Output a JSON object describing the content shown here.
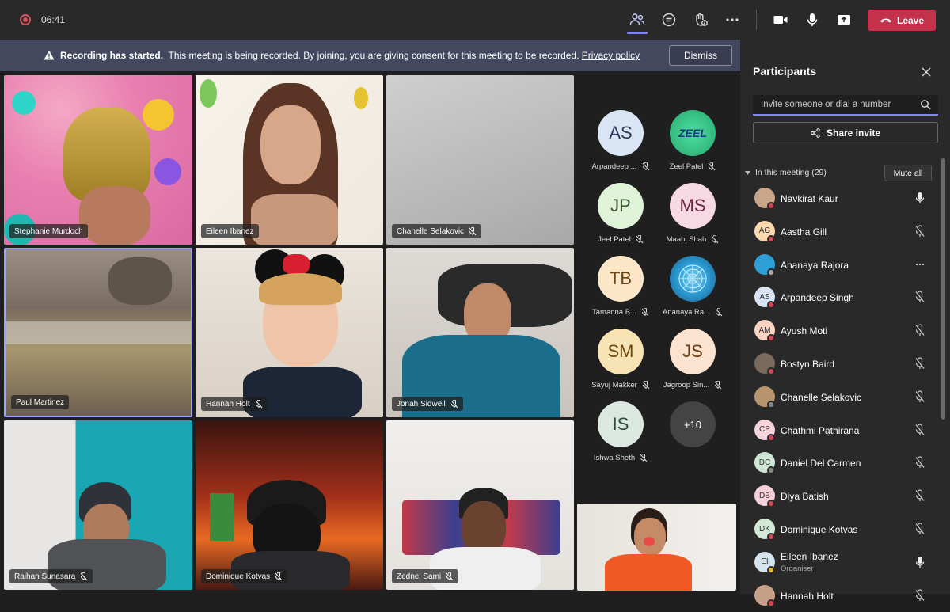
{
  "topbar": {
    "timer": "06:41",
    "leave_label": "Leave"
  },
  "banner": {
    "title": "Recording has started.",
    "message": "This meeting is being recorded. By joining, you are giving consent for this meeting to be recorded.",
    "link": "Privacy policy",
    "dismiss_label": "Dismiss"
  },
  "tiles": [
    {
      "name": "Stephanie Murdoch",
      "muted": false
    },
    {
      "name": "Eileen Ibanez",
      "muted": false
    },
    {
      "name": "Chanelle Selakovic",
      "muted": true
    },
    {
      "name": "Paul Martinez",
      "muted": false
    },
    {
      "name": "Hannah Holt",
      "muted": true
    },
    {
      "name": "Jonah Sidwell",
      "muted": true
    },
    {
      "name": "Raihan Sunasara",
      "muted": true
    },
    {
      "name": "Dominique Kotvas",
      "muted": true
    },
    {
      "name": "Zednel Sami",
      "muted": true
    }
  ],
  "avatars": [
    {
      "initials": "AS",
      "name": "Arpandeep ...",
      "bg": "#d9e4f5",
      "fg": "#2c3e5c"
    },
    {
      "initials": "",
      "name": "Zeel Patel",
      "bg": "#3fcf8e",
      "fg": "#1a3a8a",
      "logo": "ZEEL"
    },
    {
      "initials": "JP",
      "name": "Jeel Patel",
      "bg": "#dff3d8",
      "fg": "#3d5a2f"
    },
    {
      "initials": "MS",
      "name": "Maahi Shah",
      "bg": "#f7d9e3",
      "fg": "#6b2840"
    },
    {
      "initials": "TB",
      "name": "Tamanna B...",
      "bg": "#fbe7c8",
      "fg": "#6b4410"
    },
    {
      "initials": "",
      "name": "Ananaya Ra...",
      "bg": "#2d9fd6",
      "fg": "#fff"
    },
    {
      "initials": "SM",
      "name": "Sayuj Makker",
      "bg": "#f8e3b4",
      "fg": "#6b4a10"
    },
    {
      "initials": "JS",
      "name": "Jagroop Sin...",
      "bg": "#fbe3cf",
      "fg": "#6b3a10"
    },
    {
      "initials": "IS",
      "name": "Ishwa Sheth",
      "bg": "#dbe8e0",
      "fg": "#2d4a3a"
    },
    {
      "initials": "+10",
      "name": "",
      "bg": "#444",
      "fg": "#fff"
    }
  ],
  "panel": {
    "title": "Participants",
    "invite_placeholder": "Invite someone or dial a number",
    "share_label": "Share invite",
    "section_label": "In this meeting (29)",
    "mute_all_label": "Mute all",
    "participants": [
      {
        "name": "Navkirat Kaur",
        "initials": "",
        "bg": "#c9a58a",
        "status": "#d74654",
        "icon": "mic",
        "sub": ""
      },
      {
        "name": "Aastha Gill",
        "initials": "AG",
        "bg": "#fbd8b0",
        "status": "#d74654",
        "icon": "mic-off",
        "sub": ""
      },
      {
        "name": "Ananaya Rajora",
        "initials": "",
        "bg": "#2d9fd6",
        "status": "#aaaaaa",
        "icon": "more",
        "sub": ""
      },
      {
        "name": "Arpandeep Singh",
        "initials": "AS",
        "bg": "#d9e4f5",
        "status": "#d74654",
        "icon": "mic-off",
        "sub": ""
      },
      {
        "name": "Ayush Moti",
        "initials": "AM",
        "bg": "#fbd3c0",
        "status": "#d74654",
        "icon": "mic-off",
        "sub": ""
      },
      {
        "name": "Bostyn Baird",
        "initials": "",
        "bg": "#7a6a5e",
        "status": "#d74654",
        "icon": "mic-off",
        "sub": ""
      },
      {
        "name": "Chanelle Selakovic",
        "initials": "",
        "bg": "#b8956e",
        "status": "#8a8a8a",
        "icon": "mic-off",
        "sub": ""
      },
      {
        "name": "Chathmi Pathirana",
        "initials": "CP",
        "bg": "#f7d4dc",
        "status": "#d74654",
        "icon": "mic-off",
        "sub": ""
      },
      {
        "name": "Daniel Del Carmen",
        "initials": "DC",
        "bg": "#cfe6d6",
        "status": "#8a8a8a",
        "icon": "mic-off",
        "sub": ""
      },
      {
        "name": "Diya Batish",
        "initials": "DB",
        "bg": "#f5d0d8",
        "status": "#d74654",
        "icon": "mic-off",
        "sub": ""
      },
      {
        "name": "Dominique Kotvas",
        "initials": "DK",
        "bg": "#d3e8d6",
        "status": "#d74654",
        "icon": "mic-off",
        "sub": ""
      },
      {
        "name": "Eileen Ibanez",
        "initials": "EI",
        "bg": "#d6e4f0",
        "status": "#e8b73a",
        "icon": "mic",
        "sub": "Organiser"
      },
      {
        "name": "Hannah Holt",
        "initials": "",
        "bg": "#c7a08a",
        "status": "#d74654",
        "icon": "mic-off",
        "sub": ""
      }
    ]
  }
}
